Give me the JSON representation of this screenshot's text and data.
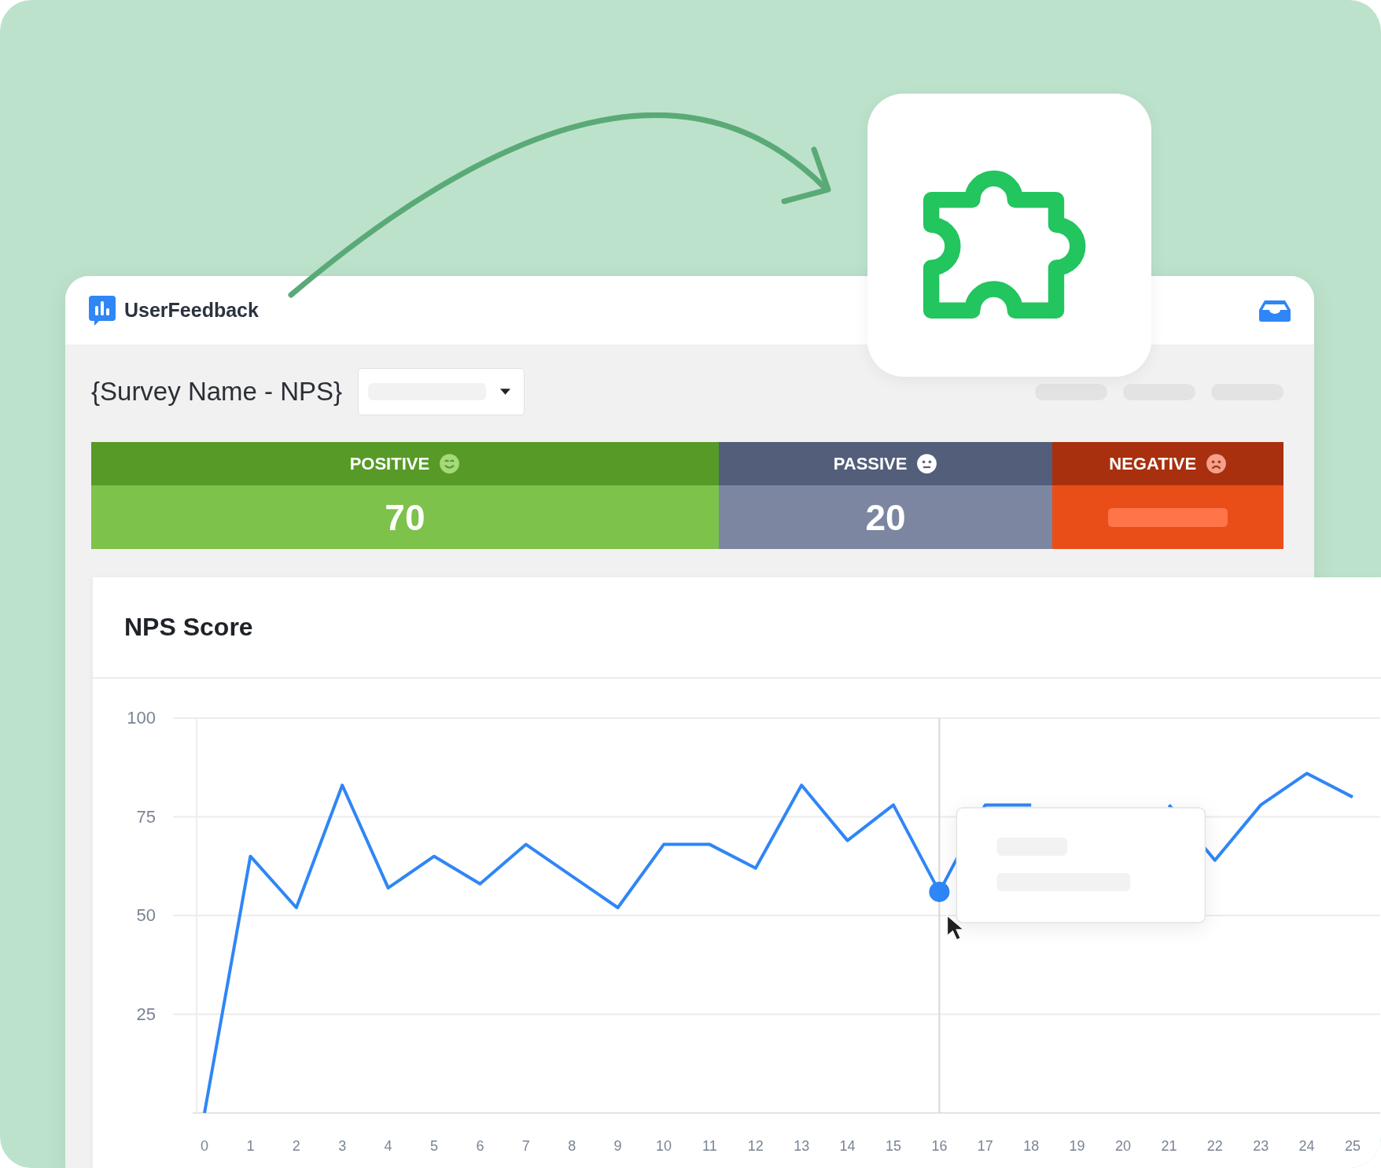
{
  "brand": {
    "name": "UserFeedback"
  },
  "survey": {
    "title": "{Survey Name - NPS}"
  },
  "summary": [
    {
      "kind": "positive",
      "label": "POSITIVE",
      "value": "70"
    },
    {
      "kind": "passive",
      "label": "PASSIVE",
      "value": "20"
    },
    {
      "kind": "negative",
      "label": "NEGATIVE",
      "redacted": true
    }
  ],
  "nps_card": {
    "title": "NPS Score",
    "chart_data": {
      "type": "line",
      "x": [
        0,
        1,
        2,
        3,
        4,
        5,
        6,
        7,
        8,
        9,
        10,
        11,
        12,
        13,
        14,
        15,
        16,
        17,
        18,
        19,
        20,
        21,
        22,
        23,
        24,
        25
      ],
      "xticks": [
        0,
        1,
        2,
        3,
        4,
        5,
        6,
        7,
        8,
        9,
        10,
        11,
        12,
        13,
        14,
        15,
        16,
        17,
        18,
        19,
        20,
        21,
        22,
        23,
        24,
        25
      ],
      "yticks": [
        25,
        50,
        75,
        100
      ],
      "xlim": [
        0,
        25.6
      ],
      "ylim": [
        0,
        100
      ],
      "grid": true,
      "series": [
        {
          "color": "#2f86f6",
          "values": [
            0,
            65,
            52,
            83,
            57,
            65,
            58,
            68,
            60,
            52,
            68,
            68,
            62,
            83,
            69,
            78,
            56,
            78,
            78,
            null,
            null,
            78,
            64,
            78,
            86,
            80
          ]
        }
      ],
      "ref_lines": [
        {
          "axis": "x",
          "value": 16,
          "color": "#d8d8d8"
        }
      ]
    }
  }
}
